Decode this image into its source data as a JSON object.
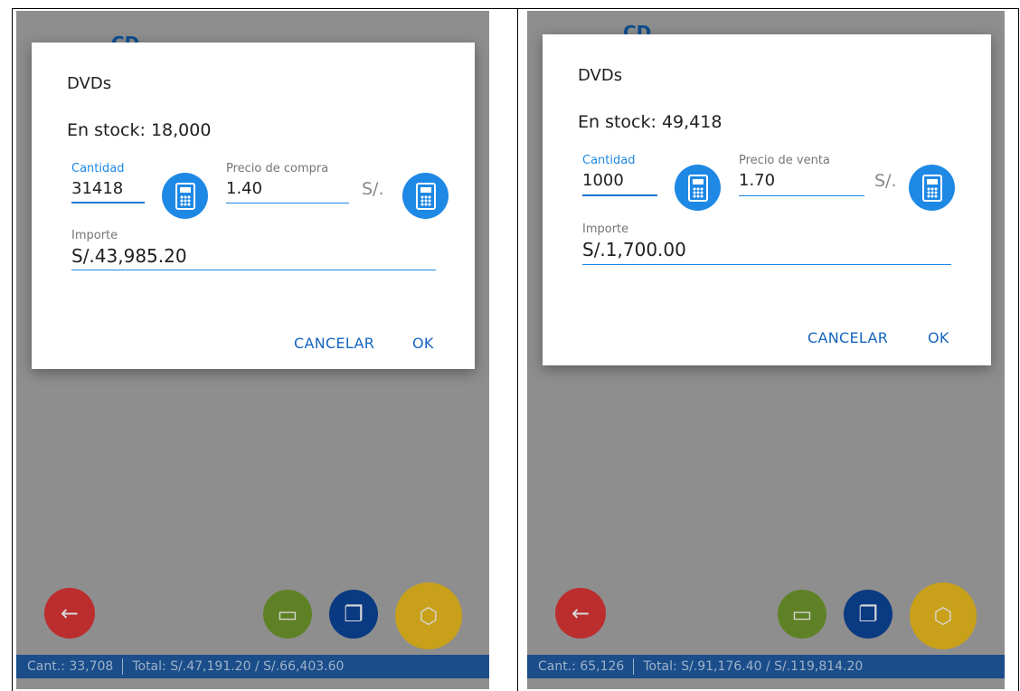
{
  "panels": [
    {
      "bg_title": "CD",
      "dialog": {
        "title": "DVDs",
        "stock": "En stock: 18,000",
        "quantity_label": "Cantidad",
        "quantity_value": "31418",
        "price_label": "Precio de compra",
        "price_value": "1.40",
        "currency": "S/.",
        "amount_label": "Importe",
        "amount_value": "S/.43,985.20",
        "cancel_label": "CANCELAR",
        "ok_label": "OK"
      },
      "status": {
        "count": "Cant.: 33,708",
        "total": "Total: S/.47,191.20 / S/.66,403.60"
      }
    },
    {
      "bg_title": "CD",
      "dialog": {
        "title": "DVDs",
        "stock": "En stock: 49,418",
        "quantity_label": "Cantidad",
        "quantity_value": "1000",
        "price_label": "Precio de venta",
        "price_value": "1.70",
        "currency": "S/.",
        "amount_label": "Importe",
        "amount_value": "S/.1,700.00",
        "cancel_label": "CANCELAR",
        "ok_label": "OK"
      },
      "status": {
        "count": "Cant.: 65,126",
        "total": "Total: S/.91,176.40 / S/.119,814.20"
      }
    }
  ],
  "icons": {
    "back": "arrow-left-icon",
    "folder": "folder-icon",
    "copy": "copy-icon",
    "box": "package-icon",
    "calculator": "calculator-icon"
  },
  "colors": {
    "accent": "#1e88e5",
    "back_fab": "#bc2d2d",
    "folder_fab": "#5f8126",
    "copy_fab": "#0a3a82",
    "box_fab": "#c8a019",
    "status_bar": "#1a4d8a"
  }
}
